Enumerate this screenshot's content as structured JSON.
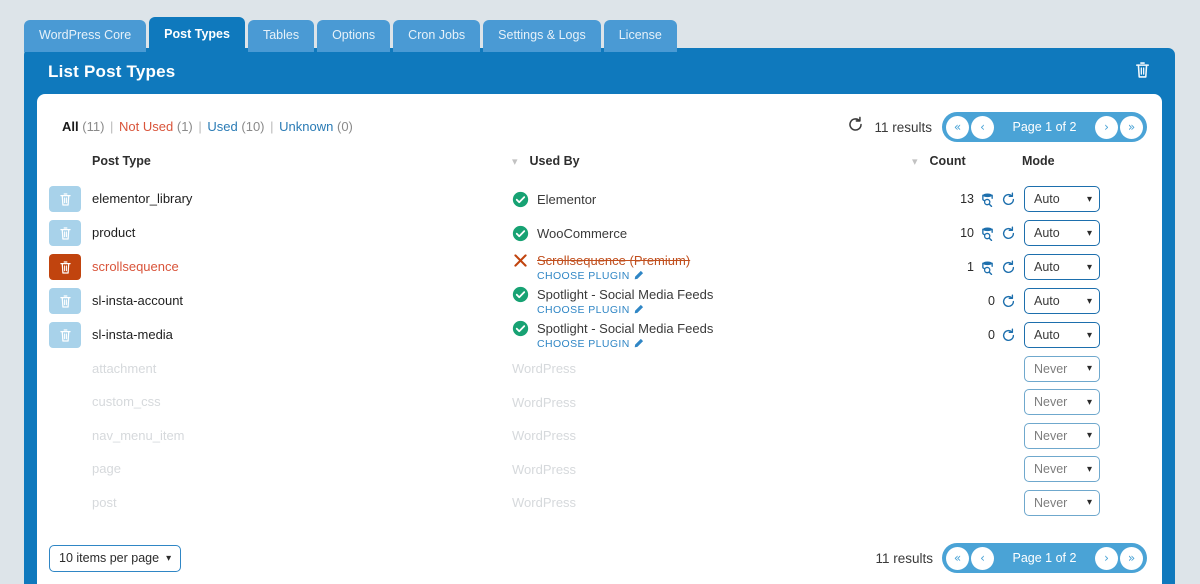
{
  "tabs": [
    {
      "label": "WordPress Core",
      "active": false
    },
    {
      "label": "Post Types",
      "active": true
    },
    {
      "label": "Tables",
      "active": false
    },
    {
      "label": "Options",
      "active": false
    },
    {
      "label": "Cron Jobs",
      "active": false
    },
    {
      "label": "Settings & Logs",
      "active": false
    },
    {
      "label": "License",
      "active": false
    }
  ],
  "header": {
    "title": "List Post Types",
    "trash_icon": "trash-icon"
  },
  "filters": {
    "all_label": "All",
    "all_count": "(11)",
    "not_used_label": "Not Used",
    "not_used_count": "(1)",
    "used_label": "Used",
    "used_count": "(10)",
    "unknown_label": "Unknown",
    "unknown_count": "(0)",
    "separator": "|"
  },
  "toolbar": {
    "results_text": "11 results",
    "refresh_icon": "refresh-icon",
    "pager": {
      "first_label": "«",
      "prev_label": "‹",
      "page_label": "Page 1 of 2",
      "next_label": "›",
      "last_label": "»"
    }
  },
  "table": {
    "columns": {
      "post_type": "Post Type",
      "used_by": "Used By",
      "count": "Count",
      "mode": "Mode"
    },
    "rows": [
      {
        "post_type": "elementor_library",
        "used_by": "Elementor",
        "status": "ok",
        "choose_plugin": null,
        "count": "13",
        "has_inspect": true,
        "has_refresh": true,
        "mode": "Auto",
        "dim": false,
        "danger": false
      },
      {
        "post_type": "product",
        "used_by": "WooCommerce",
        "status": "ok",
        "choose_plugin": null,
        "count": "10",
        "has_inspect": true,
        "has_refresh": true,
        "mode": "Auto",
        "dim": false,
        "danger": false
      },
      {
        "post_type": "scrollsequence",
        "used_by": "Scrollsequence (Premium)",
        "status": "error",
        "choose_plugin": "CHOOSE PLUGIN",
        "count": "1",
        "has_inspect": true,
        "has_refresh": true,
        "mode": "Auto",
        "dim": false,
        "danger": true
      },
      {
        "post_type": "sl-insta-account",
        "used_by": "Spotlight - Social Media Feeds",
        "status": "ok",
        "choose_plugin": "CHOOSE PLUGIN",
        "count": "0",
        "has_inspect": false,
        "has_refresh": true,
        "mode": "Auto",
        "dim": false,
        "danger": false
      },
      {
        "post_type": "sl-insta-media",
        "used_by": "Spotlight - Social Media Feeds",
        "status": "ok",
        "choose_plugin": "CHOOSE PLUGIN",
        "count": "0",
        "has_inspect": false,
        "has_refresh": true,
        "mode": "Auto",
        "dim": false,
        "danger": false
      },
      {
        "post_type": "attachment",
        "used_by": "WordPress",
        "status": "none",
        "choose_plugin": null,
        "count": "",
        "has_inspect": false,
        "has_refresh": false,
        "mode": "Never",
        "dim": true,
        "danger": false
      },
      {
        "post_type": "custom_css",
        "used_by": "WordPress",
        "status": "none",
        "choose_plugin": null,
        "count": "",
        "has_inspect": false,
        "has_refresh": false,
        "mode": "Never",
        "dim": true,
        "danger": false
      },
      {
        "post_type": "nav_menu_item",
        "used_by": "WordPress",
        "status": "none",
        "choose_plugin": null,
        "count": "",
        "has_inspect": false,
        "has_refresh": false,
        "mode": "Never",
        "dim": true,
        "danger": false
      },
      {
        "post_type": "page",
        "used_by": "WordPress",
        "status": "none",
        "choose_plugin": null,
        "count": "",
        "has_inspect": false,
        "has_refresh": false,
        "mode": "Never",
        "dim": true,
        "danger": false
      },
      {
        "post_type": "post",
        "used_by": "WordPress",
        "status": "none",
        "choose_plugin": null,
        "count": "",
        "has_inspect": false,
        "has_refresh": false,
        "mode": "Never",
        "dim": true,
        "danger": false
      }
    ]
  },
  "footer": {
    "per_page_label": "10 items per page",
    "results_text": "11 results",
    "pager": {
      "first_label": "«",
      "prev_label": "‹",
      "page_label": "Page 1 of 2",
      "next_label": "›",
      "last_label": "»"
    }
  },
  "colors": {
    "panel_blue": "#0f79bd",
    "tab_inactive": "#4a9ad4",
    "pager_blue": "#4aa3d6",
    "danger_red": "#c1440e",
    "danger_text": "#d9543a",
    "ok_green": "#17a273",
    "link_blue": "#2f86c5",
    "page_bg": "#dde4e9"
  }
}
